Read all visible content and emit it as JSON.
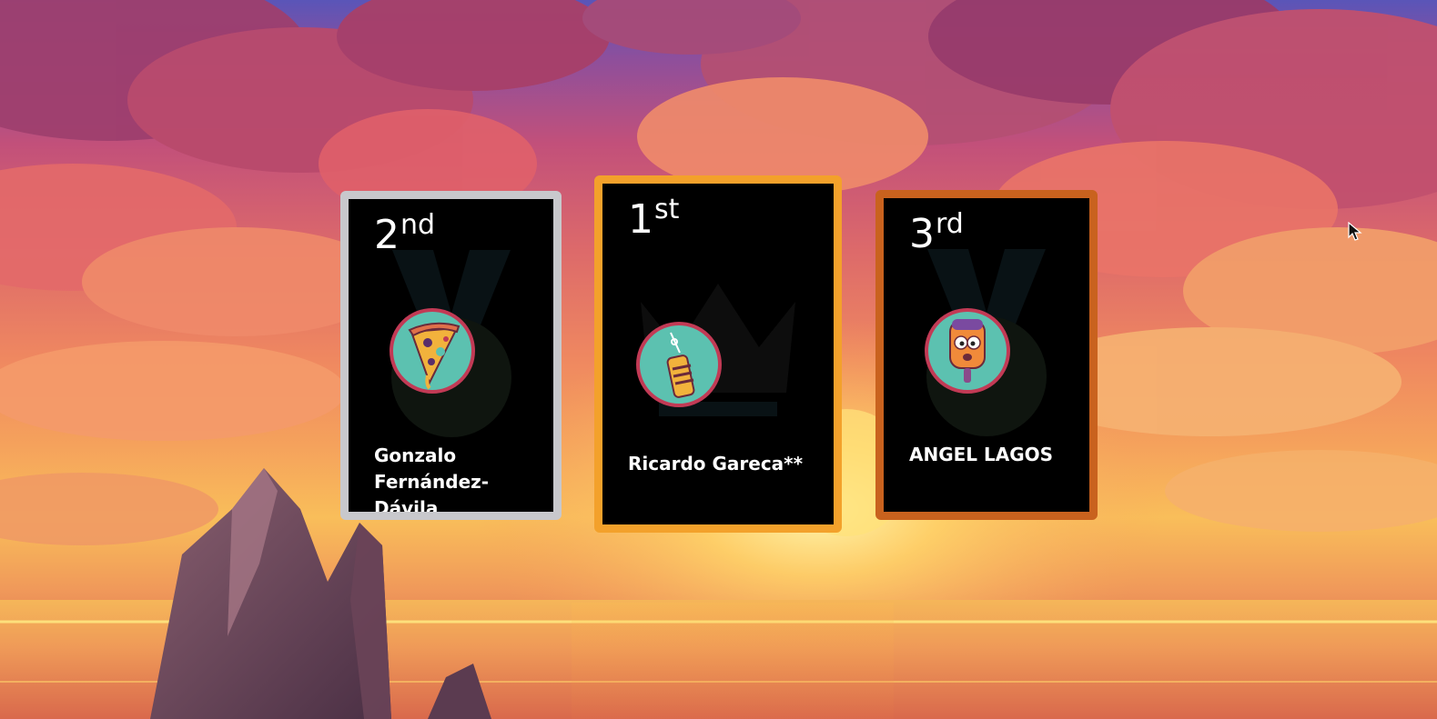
{
  "podium": {
    "second": {
      "rank_number": "2",
      "rank_suffix": "nd",
      "player_name": "Gonzalo Fernández-Dávila",
      "avatar_icon": "pizza-slice-icon",
      "frame_color": "#c8c8cc"
    },
    "first": {
      "rank_number": "1",
      "rank_suffix": "st",
      "player_name": "Ricardo Gareca**",
      "avatar_icon": "pencil-sharpener-icon",
      "frame_color": "#f3a12b"
    },
    "third": {
      "rank_number": "3",
      "rank_suffix": "rd",
      "player_name": "ANGEL LAGOS",
      "avatar_icon": "popsicle-character-icon",
      "frame_color": "#c9621e"
    }
  },
  "colors": {
    "avatar_bg": "#5cc1b0",
    "avatar_ring": "#c23a55",
    "card_bg": "#000000"
  }
}
